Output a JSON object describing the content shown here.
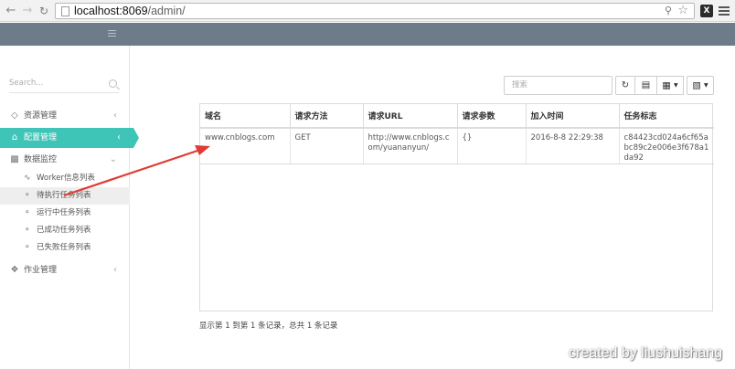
{
  "browser": {
    "url_host": "localhost:8069",
    "url_path": "/admin/",
    "ext_label": "X"
  },
  "sidebar": {
    "search_placeholder": "Search...",
    "items": [
      {
        "label": "资源管理",
        "icon": "diamond-icon"
      },
      {
        "label": "配置管理",
        "icon": "home-icon"
      },
      {
        "label": "数据监控",
        "icon": "bar-chart-icon"
      }
    ],
    "monitor_children": [
      "Worker信息列表",
      "待执行任务列表",
      "运行中任务列表",
      "已成功任务列表",
      "已失败任务列表"
    ],
    "ops": {
      "label": "作业管理",
      "icon": "tag-icon"
    }
  },
  "toolbar": {
    "search_placeholder": "搜索"
  },
  "table": {
    "headers": [
      "域名",
      "请求方法",
      "请求URL",
      "请求参数",
      "加入时间",
      "任务标志"
    ],
    "rows": [
      [
        "www.cnblogs.com",
        "GET",
        "http://www.cnblogs.com/yuananyun/",
        "{}",
        "2016-8-8 22:29:38",
        "c84423cd024a6cf65abc89c2e006e3f678a1da92"
      ]
    ]
  },
  "pager": {
    "summary": "显示第 1 到第 1 条记录，总共 1 条记录"
  },
  "watermark": "created by liushuishang",
  "colors": {
    "header_bar": "#6e7b89",
    "active_item": "#3fc5b8",
    "arrow": "#e03a32"
  }
}
